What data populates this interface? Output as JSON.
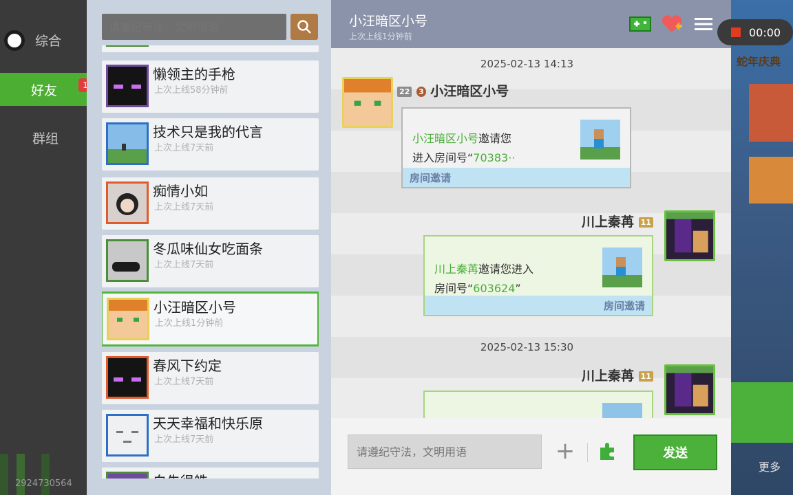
{
  "nav": {
    "items": [
      {
        "label": "综合",
        "active": false
      },
      {
        "label": "好友",
        "active": true,
        "badge": "1"
      },
      {
        "label": "群组",
        "active": false
      }
    ],
    "uid": "2924730564"
  },
  "friends": {
    "search_placeholder": "请遵纪守法，文明用语",
    "list": [
      {
        "name": "懒领主的手枪",
        "status": "上次上线58分钟前"
      },
      {
        "name": "技术只是我的代言",
        "status": "上次上线7天前"
      },
      {
        "name": "痴情小如",
        "status": "上次上线7天前"
      },
      {
        "name": "冬瓜味仙女吃面条",
        "status": "上次上线7天前"
      },
      {
        "name": "小汪暗区小号",
        "status": "上次上线1分钟前",
        "selected": true
      },
      {
        "name": "春风下约定",
        "status": "上次上线7天前"
      },
      {
        "name": "天天幸福和快乐原",
        "status": "上次上线7天前"
      },
      {
        "name": "白先很皓",
        "status": ""
      }
    ]
  },
  "chat": {
    "title": "小汪暗区小号",
    "subtitle": "上次上线1分钟前",
    "messages": [
      {
        "timestamp": "2025-02-13 14:13",
        "sender": "小汪暗区小号",
        "level_a": "22",
        "level_b": "3",
        "line1_name": "小汪暗区小号",
        "line1_rest": "邀请您",
        "line2_pre": "进入房间号“",
        "line2_num": "70383··",
        "footer": "房间邀请"
      },
      {
        "sender": "川上秦苒",
        "level": "11",
        "line1_name": "川上秦苒",
        "line1_rest": "邀请您进入",
        "line2_pre": "房间号“",
        "line2_num": "603624",
        "line2_post": "”",
        "footer": "房间邀请"
      },
      {
        "timestamp": "2025-02-13 15:30",
        "sender": "川上秦苒",
        "level": "11"
      }
    ],
    "input_placeholder": "请遵纪守法，文明用语",
    "plus_label": "+",
    "send_label": "发送"
  },
  "recording": {
    "time": "00:00"
  },
  "side": {
    "banner": "蛇年庆典",
    "more": "更多"
  }
}
